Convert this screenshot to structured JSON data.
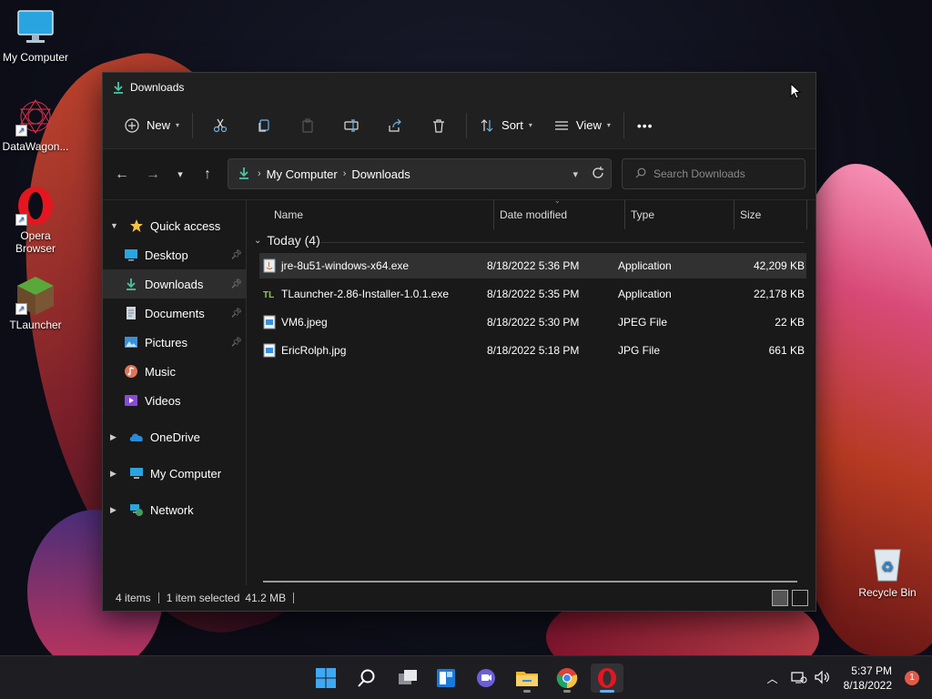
{
  "desktop": {
    "icons": [
      {
        "label": "My Computer"
      },
      {
        "label": "DataWagon..."
      },
      {
        "label": "Opera Browser"
      },
      {
        "label": "TLauncher"
      },
      {
        "label": "Recycle Bin"
      }
    ]
  },
  "window": {
    "title": "Downloads",
    "toolbar": {
      "new_label": "New",
      "sort_label": "Sort",
      "view_label": "View",
      "more_label": "•••"
    },
    "address": {
      "crumbs": [
        "My Computer",
        "Downloads"
      ],
      "search_placeholder": "Search Downloads"
    },
    "sidebar": {
      "items": [
        {
          "label": "Quick access"
        },
        {
          "label": "Desktop"
        },
        {
          "label": "Downloads"
        },
        {
          "label": "Documents"
        },
        {
          "label": "Pictures"
        },
        {
          "label": "Music"
        },
        {
          "label": "Videos"
        },
        {
          "label": "OneDrive"
        },
        {
          "label": "My Computer"
        },
        {
          "label": "Network"
        }
      ]
    },
    "columns": {
      "name": "Name",
      "date": "Date modified",
      "type": "Type",
      "size": "Size"
    },
    "group": {
      "label": "Today (4)"
    },
    "files": [
      {
        "name": "jre-8u51-windows-x64.exe",
        "date": "8/18/2022 5:36 PM",
        "type": "Application",
        "size": "42,209 KB"
      },
      {
        "name": "TLauncher-2.86-Installer-1.0.1.exe",
        "date": "8/18/2022 5:35 PM",
        "type": "Application",
        "size": "22,178 KB"
      },
      {
        "name": "VM6.jpeg",
        "date": "8/18/2022 5:30 PM",
        "type": "JPEG File",
        "size": "22 KB"
      },
      {
        "name": "EricRolph.jpg",
        "date": "8/18/2022 5:18 PM",
        "type": "JPG File",
        "size": "661 KB"
      }
    ],
    "status": {
      "items": "4 items",
      "selected": "1 item selected",
      "selected_size": "41.2 MB"
    }
  },
  "taskbar": {
    "clock_time": "5:37 PM",
    "clock_date": "8/18/2022",
    "notification_count": "1"
  },
  "colors": {
    "accent": "#4cc2a4",
    "taskbar_active": "#5fb2f2"
  }
}
